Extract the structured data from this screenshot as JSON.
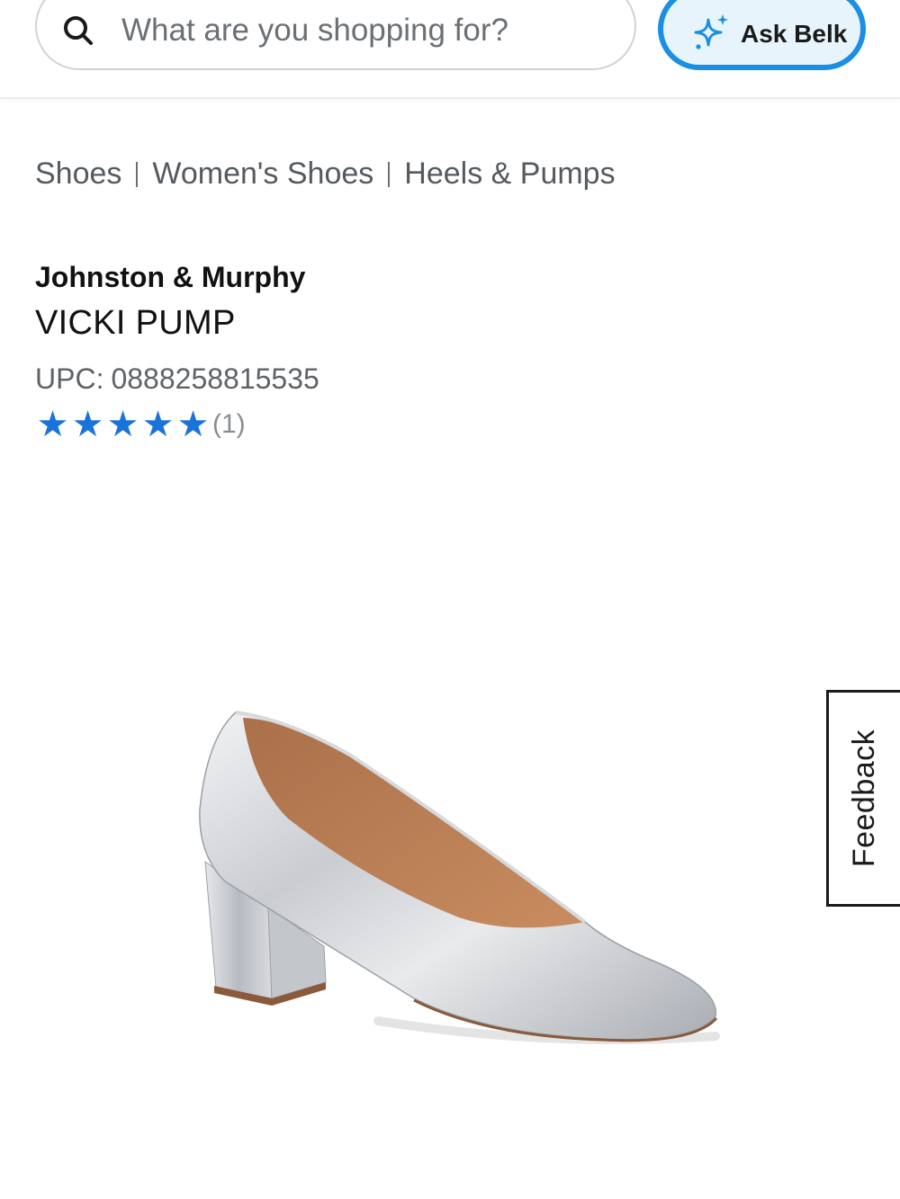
{
  "header": {
    "search": {
      "placeholder": "What are you shopping for?"
    },
    "ask_button": {
      "label": "Ask Belk",
      "icon": "sparkle-icon"
    },
    "colors": {
      "accent": "#1a8fe3",
      "ask_bg": "#e8f4fc"
    }
  },
  "breadcrumb": {
    "items": [
      "Shoes",
      "Women's Shoes",
      "Heels & Pumps"
    ]
  },
  "product": {
    "brand": "Johnston & Murphy",
    "name": "VICKI PUMP",
    "upc_label": "UPC:",
    "upc_value": "0888258815535",
    "rating": {
      "stars": 5,
      "max_stars": 5,
      "review_count": "(1)",
      "star_color": "#1a73d9"
    },
    "image_alt": "silver-pump-shoe"
  },
  "feedback_tab": {
    "label": "Feedback"
  }
}
